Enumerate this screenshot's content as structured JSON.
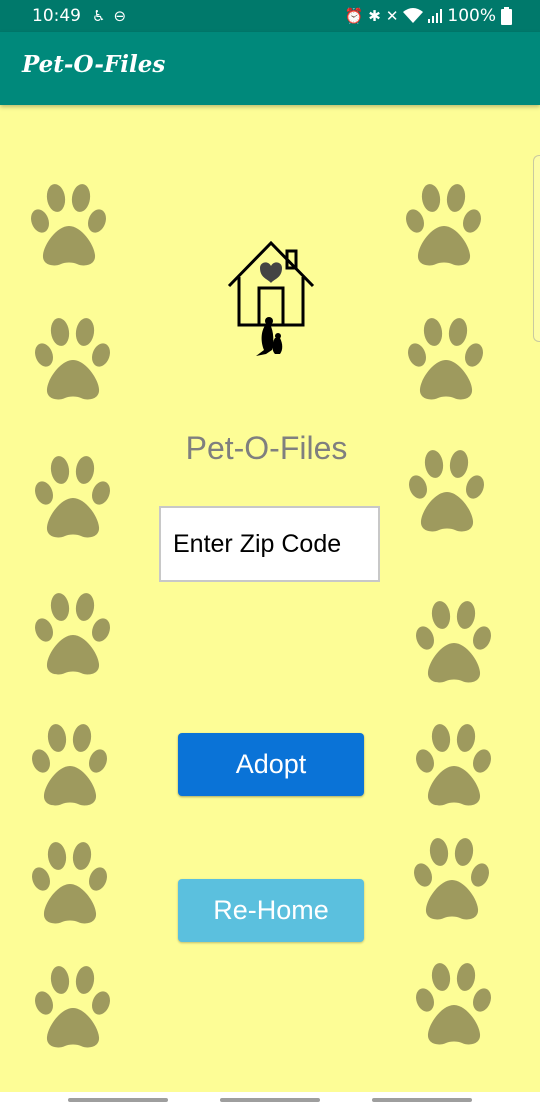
{
  "status_bar": {
    "time": "10:49",
    "battery": "100%",
    "left_icons": [
      "accessibility-icon",
      "do-not-disturb-icon"
    ],
    "right_icons": [
      "alarm-icon",
      "bluetooth-icon",
      "mute-icon",
      "wifi-icon",
      "signal-icon",
      "battery-icon"
    ]
  },
  "app_bar": {
    "title": "Pet-O-Files"
  },
  "main": {
    "logo_icon": "house-heart-pets-icon",
    "app_name": "Pet-O-Files",
    "zip_input": {
      "placeholder": "Enter Zip Code",
      "value": ""
    },
    "adopt_label": "Adopt",
    "rehome_label": "Re-Home"
  },
  "decor": {
    "paw_icon": "paw-print-icon"
  },
  "colors": {
    "status_bar": "#00796b",
    "app_bar": "#00897b",
    "background": "#fdfd96",
    "paw": "#9e9a5e",
    "adopt_button": "#0a73d7",
    "rehome_button": "#5bc0de",
    "app_name_text": "#7f7f7f"
  }
}
